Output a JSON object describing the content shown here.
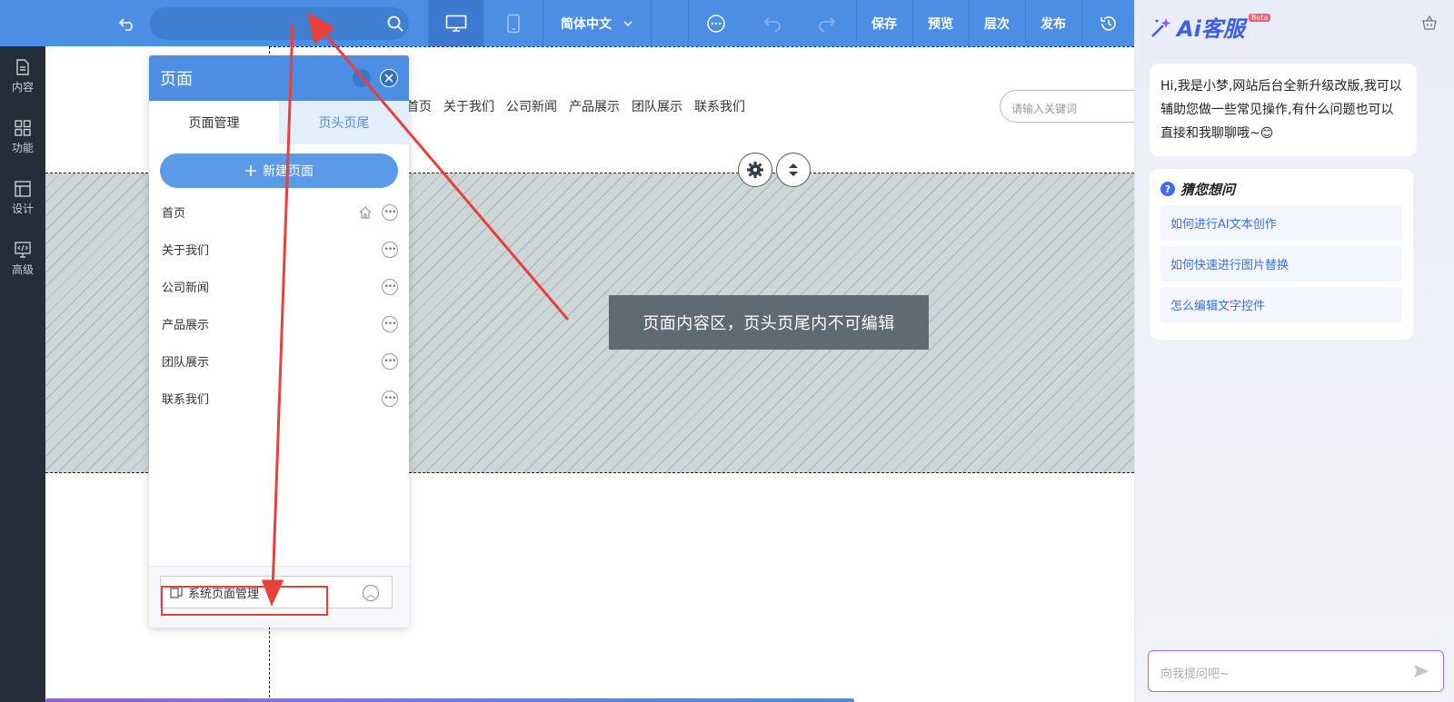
{
  "toolbar": {
    "lang_label": "简体中文",
    "save_label": "保存",
    "preview_label": "预览",
    "layers_label": "层次",
    "publish_label": "发布",
    "bg_color": "#4c8ee3"
  },
  "sidebar": {
    "items": [
      {
        "label": "内容",
        "icon": "document-icon"
      },
      {
        "label": "功能",
        "icon": "grid-icon"
      },
      {
        "label": "设计",
        "icon": "layout-icon"
      },
      {
        "label": "高级",
        "icon": "code-monitor-icon"
      }
    ]
  },
  "site": {
    "nav": [
      "首页",
      "关于我们",
      "公司新闻",
      "产品展示",
      "团队展示",
      "联系我们"
    ],
    "search_placeholder": "请输入关键词",
    "content_notice": "页面内容区，页头页尾内不可编辑"
  },
  "panel": {
    "title": "页面",
    "tabs": [
      "页面管理",
      "页头页尾"
    ],
    "new_page_label": "新建页面",
    "pages": [
      "首页",
      "关于我们",
      "公司新闻",
      "产品展示",
      "团队展示",
      "联系我们"
    ],
    "system_pages_label": "系统页面管理"
  },
  "assistant": {
    "brand": "Ai客服",
    "badge": "Beta",
    "greeting": "Hi,我是小梦,网站后台全新升级改版,我可以辅助您做一些常见操作,有什么问题也可以直接和我聊聊哦~😊",
    "guess_title": "猜您想问",
    "questions": [
      "如何进行AI文本创作",
      "如何快速进行图片替换",
      "怎么编辑文字控件"
    ],
    "input_placeholder": "向我提问吧~"
  },
  "colors": {
    "accent": "#4c8ee3",
    "annotation": "#e8403a",
    "sidebar_bg": "#252d3a"
  }
}
